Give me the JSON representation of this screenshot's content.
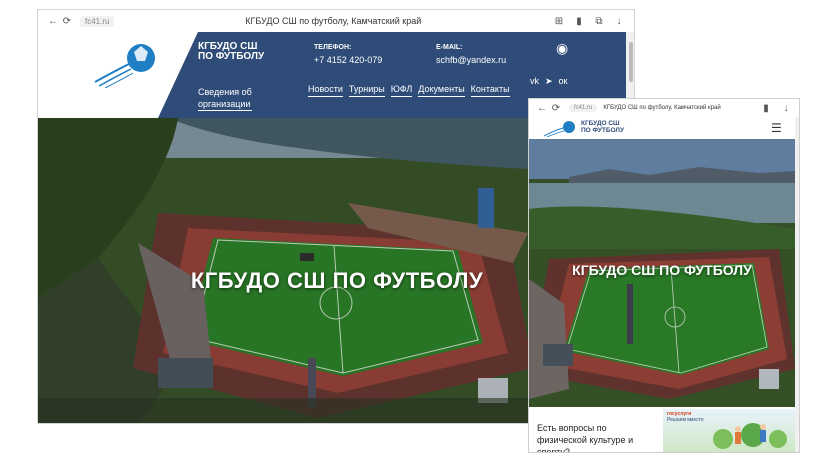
{
  "desktop": {
    "browser": {
      "url": "fc41.ru",
      "title": "КГБУДО СШ по футболу, Камчатский край"
    },
    "header": {
      "org_line1": "КГБУДО СШ",
      "org_line2": "ПО ФУТБОЛУ",
      "about_line1": "Сведения об",
      "about_line2": "организации",
      "phone_label": "Телефон:",
      "phone": "+7 4152 420-079",
      "email_label": "E-mail:",
      "email": "schfb@yandex.ru",
      "nav": [
        "Новости",
        "Турниры",
        "ЮФЛ",
        "Документы",
        "Контакты"
      ],
      "social": [
        "vk-icon",
        "telegram-icon",
        "ok-icon"
      ],
      "accessibility_icon": "eye-icon"
    },
    "hero": {
      "title": "КГБУДО СШ ПО ФУТБОЛУ"
    }
  },
  "mobile": {
    "browser": {
      "url": "fc41.ru",
      "title": "КГБУДО СШ по футболу, Камчатский край"
    },
    "header": {
      "org_line1": "КГБУДО СШ",
      "org_line2": "ПО ФУТБОЛУ",
      "menu_icon": "hamburger-icon"
    },
    "hero": {
      "title": "КГБУДО СШ ПО ФУТБОЛУ"
    },
    "bottom": {
      "question": "Есть вопросы по физической культуре и спорту?",
      "gosuslugi_line1": "госуслуги",
      "gosuslugi_line2": "Решаем вместе"
    }
  },
  "colors": {
    "header_blue": "#2f4c78",
    "logo_blue": "#1e7fc4",
    "field_green": "#2f8a2c",
    "track_red": "#a0473c"
  }
}
